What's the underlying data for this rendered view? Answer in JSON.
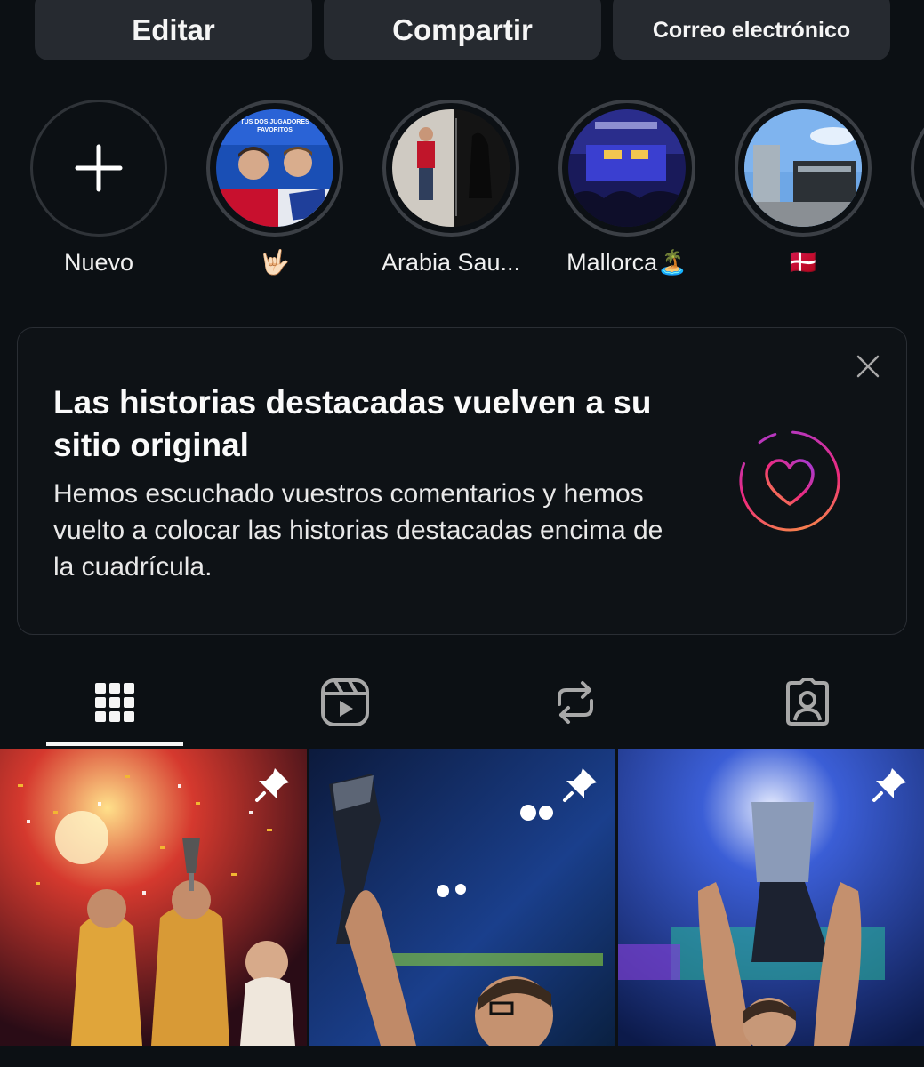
{
  "actions": {
    "edit_label": "Editar",
    "share_label": "Compartir",
    "email_label": "Correo electrónico"
  },
  "highlights": [
    {
      "label": "Nuevo",
      "icon": "plus-icon"
    },
    {
      "label": "🤟🏻",
      "image": "TUS DOS JUGADORES FAVORITOS"
    },
    {
      "label": "Arabia Sau..."
    },
    {
      "label": "Mallorca🏝️"
    },
    {
      "label": "🇩🇰"
    }
  ],
  "highlight_text": {
    "h1_caption": "TUS DOS JUGADORES FAVORITOS"
  },
  "card": {
    "title": "Las historias destacadas vuelven a su sitio original",
    "body": "Hemos escuchado vuestros comentarios y hemos vuelto a colocar las historias destacadas encima de la cuadrícula.",
    "close_icon": "close-icon",
    "illustration_icon": "heart-ring-icon"
  },
  "tabs": [
    {
      "name": "grid",
      "icon": "grid-icon",
      "active": true
    },
    {
      "name": "reels",
      "icon": "reels-icon",
      "active": false
    },
    {
      "name": "reposts",
      "icon": "repost-icon",
      "active": false
    },
    {
      "name": "tagged",
      "icon": "tagged-icon",
      "active": false
    }
  ],
  "posts": [
    {
      "pinned": true,
      "icon": "pin-icon"
    },
    {
      "pinned": true,
      "icon": "pin-icon"
    },
    {
      "pinned": true,
      "icon": "pin-icon"
    }
  ],
  "colors": {
    "background": "#0c1014",
    "button": "#262a30",
    "text": "#f5f5f5",
    "gradient_start": "#f77737",
    "gradient_mid": "#e1306c",
    "gradient_end": "#833ab4"
  }
}
